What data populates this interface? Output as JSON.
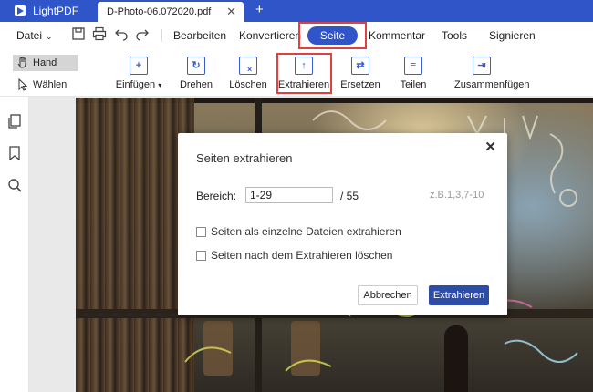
{
  "app": {
    "name": "LightPDF"
  },
  "tabs": [
    {
      "title": "D-Photo-06.072020.pdf",
      "close_glyph": "✕"
    }
  ],
  "new_tab_glyph": "+",
  "menubar": {
    "file_label": "Datei",
    "quick_icons": [
      "save-icon",
      "print-icon",
      "undo-icon",
      "redo-icon"
    ],
    "items": [
      "Bearbeiten",
      "Konvertieren",
      "Seite",
      "Kommentar",
      "Tools",
      "Signieren"
    ],
    "active": "Seite"
  },
  "modes": {
    "hand": "Hand",
    "select": "Wählen"
  },
  "ribbon": {
    "tools": [
      {
        "label": "Einfügen",
        "icon": "insert-page-icon",
        "has_dropdown": true
      },
      {
        "label": "Drehen",
        "icon": "rotate-page-icon"
      },
      {
        "label": "Löschen",
        "icon": "delete-page-icon"
      },
      {
        "label": "Extrahieren",
        "icon": "extract-page-icon",
        "highlighted": true
      },
      {
        "label": "Ersetzen",
        "icon": "replace-page-icon"
      },
      {
        "label": "Teilen",
        "icon": "split-page-icon"
      },
      {
        "label": "Zusammenfügen",
        "icon": "merge-page-icon"
      }
    ]
  },
  "sidebar": {
    "icons": [
      "thumbnails-icon",
      "bookmark-icon",
      "search-icon"
    ]
  },
  "dialog": {
    "title": "Seiten extrahieren",
    "close_glyph": "✕",
    "range_label": "Bereich:",
    "range_value": "1-29",
    "range_total": "/ 55",
    "range_hint": "z.B.1,3,7-10",
    "options": [
      {
        "label": "Seiten als einzelne Dateien extrahieren",
        "checked": false
      },
      {
        "label": "Seiten nach dem Extrahieren löschen",
        "checked": false
      }
    ],
    "cancel_label": "Abbrechen",
    "confirm_label": "Extrahieren"
  },
  "colors": {
    "brand": "#2f55c8",
    "highlight": "#e04040",
    "confirm_button": "#2c4ca8"
  }
}
